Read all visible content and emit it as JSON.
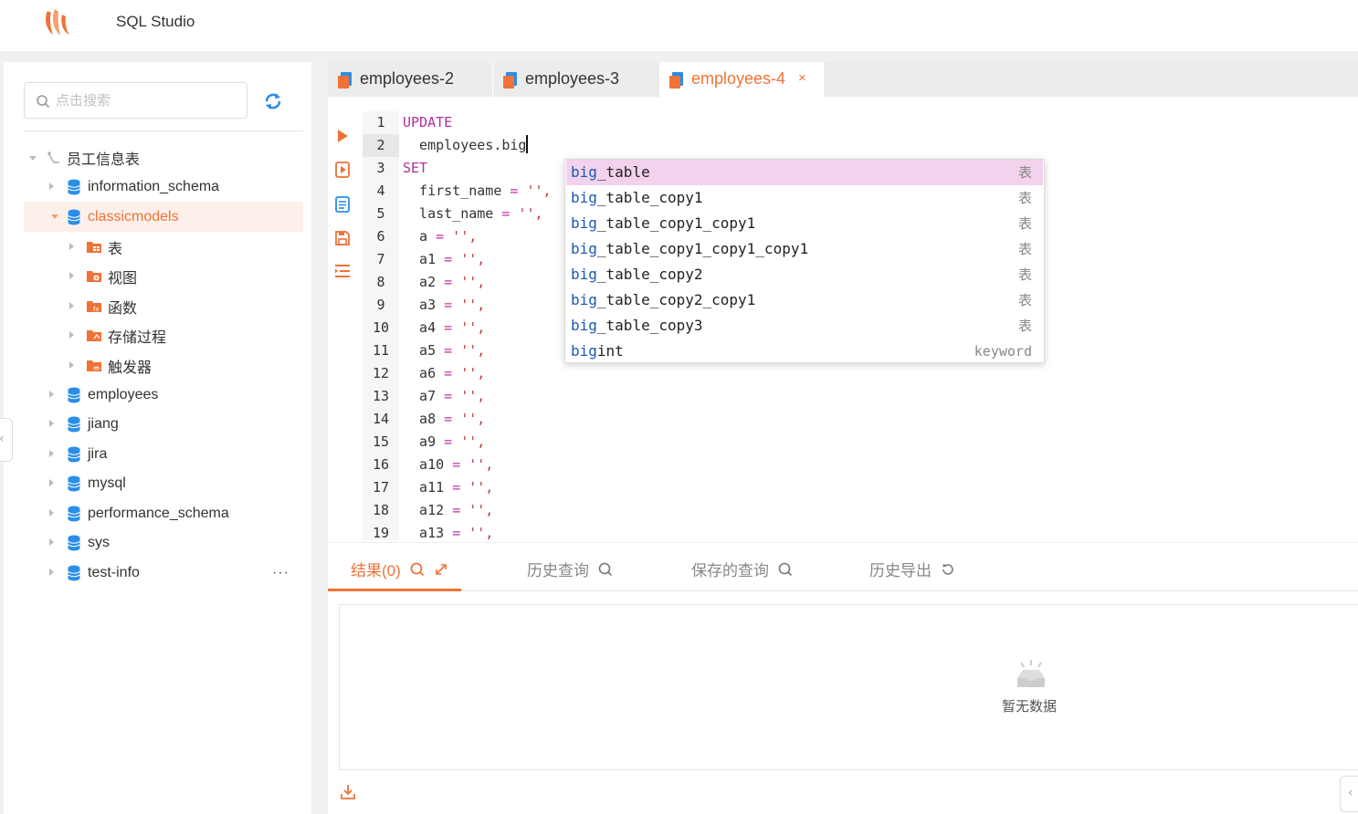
{
  "app": {
    "title": "SQL Studio"
  },
  "sidebar": {
    "search_placeholder": "点击搜索",
    "tree": {
      "root_label": "员工信息表",
      "databases": [
        {
          "label": "information_schema"
        },
        {
          "label": "classicmodels"
        },
        {
          "label": "employees"
        },
        {
          "label": "jiang"
        },
        {
          "label": "jira"
        },
        {
          "label": "mysql"
        },
        {
          "label": "performance_schema"
        },
        {
          "label": "sys"
        },
        {
          "label": "test-info"
        }
      ],
      "classicmodels_children": [
        {
          "label": "表"
        },
        {
          "label": "视图"
        },
        {
          "label": "函数"
        },
        {
          "label": "存储过程"
        },
        {
          "label": "触发器"
        }
      ],
      "more": "···"
    }
  },
  "tabs": [
    {
      "label": "employees-2"
    },
    {
      "label": "employees-3"
    },
    {
      "label": "employees-4",
      "close": "×"
    }
  ],
  "editor": {
    "line_numbers": [
      "1",
      "2",
      "3",
      "4",
      "5",
      "6",
      "7",
      "8",
      "9",
      "10",
      "11",
      "12",
      "13",
      "14",
      "15",
      "16",
      "17",
      "18",
      "19"
    ],
    "lines": {
      "l1": "UPDATE",
      "l2": "  employees.big",
      "l3": "SET",
      "l4a": "  first_name ",
      "l4b": "=",
      "l4c": " '',",
      "l5a": "  last_name ",
      "l5b": "=",
      "l5c": " '',",
      "l6a": "  a ",
      "l6b": "=",
      "l6c": " '',",
      "l7a": "  a1 ",
      "l7b": "=",
      "l7c": " '',",
      "l8a": "  a2 ",
      "l8b": "=",
      "l8c": " '',",
      "l9a": "  a3 ",
      "l9b": "=",
      "l9c": " '',",
      "l10a": "  a4 ",
      "l10b": "=",
      "l10c": " '',",
      "l11a": "  a5 ",
      "l11b": "=",
      "l11c": " '',",
      "l12a": "  a6 ",
      "l12b": "=",
      "l12c": " '',",
      "l13a": "  a7 ",
      "l13b": "=",
      "l13c": " '',",
      "l14a": "  a8 ",
      "l14b": "=",
      "l14c": " '',",
      "l15a": "  a9 ",
      "l15b": "=",
      "l15c": " '',",
      "l16a": "  a10 ",
      "l16b": "=",
      "l16c": " '',",
      "l17a": "  a11 ",
      "l17b": "=",
      "l17c": " '',",
      "l18a": "  a12 ",
      "l18b": "=",
      "l18c": " '',",
      "l19a": "  a13 ",
      "l19b": "=",
      "l19c": " '',"
    }
  },
  "autocomplete": {
    "match": "big",
    "items": [
      {
        "rest": "_table",
        "type": "表"
      },
      {
        "rest": "_table_copy1",
        "type": "表"
      },
      {
        "rest": "_table_copy1_copy1",
        "type": "表"
      },
      {
        "rest": "_table_copy1_copy1_copy1",
        "type": "表"
      },
      {
        "rest": "_table_copy2",
        "type": "表"
      },
      {
        "rest": "_table_copy2_copy1",
        "type": "表"
      },
      {
        "rest": "_table_copy3",
        "type": "表"
      },
      {
        "rest": "int",
        "type": "keyword"
      }
    ]
  },
  "results": {
    "tabs": [
      {
        "label": "结果(0)"
      },
      {
        "label": "历史查询"
      },
      {
        "label": "保存的查询"
      },
      {
        "label": "历史导出"
      }
    ],
    "empty_text": "暂无数据"
  },
  "colors": {
    "accent": "#f07236",
    "selection": "#f2d2ec",
    "keyword": "#b0309e"
  }
}
